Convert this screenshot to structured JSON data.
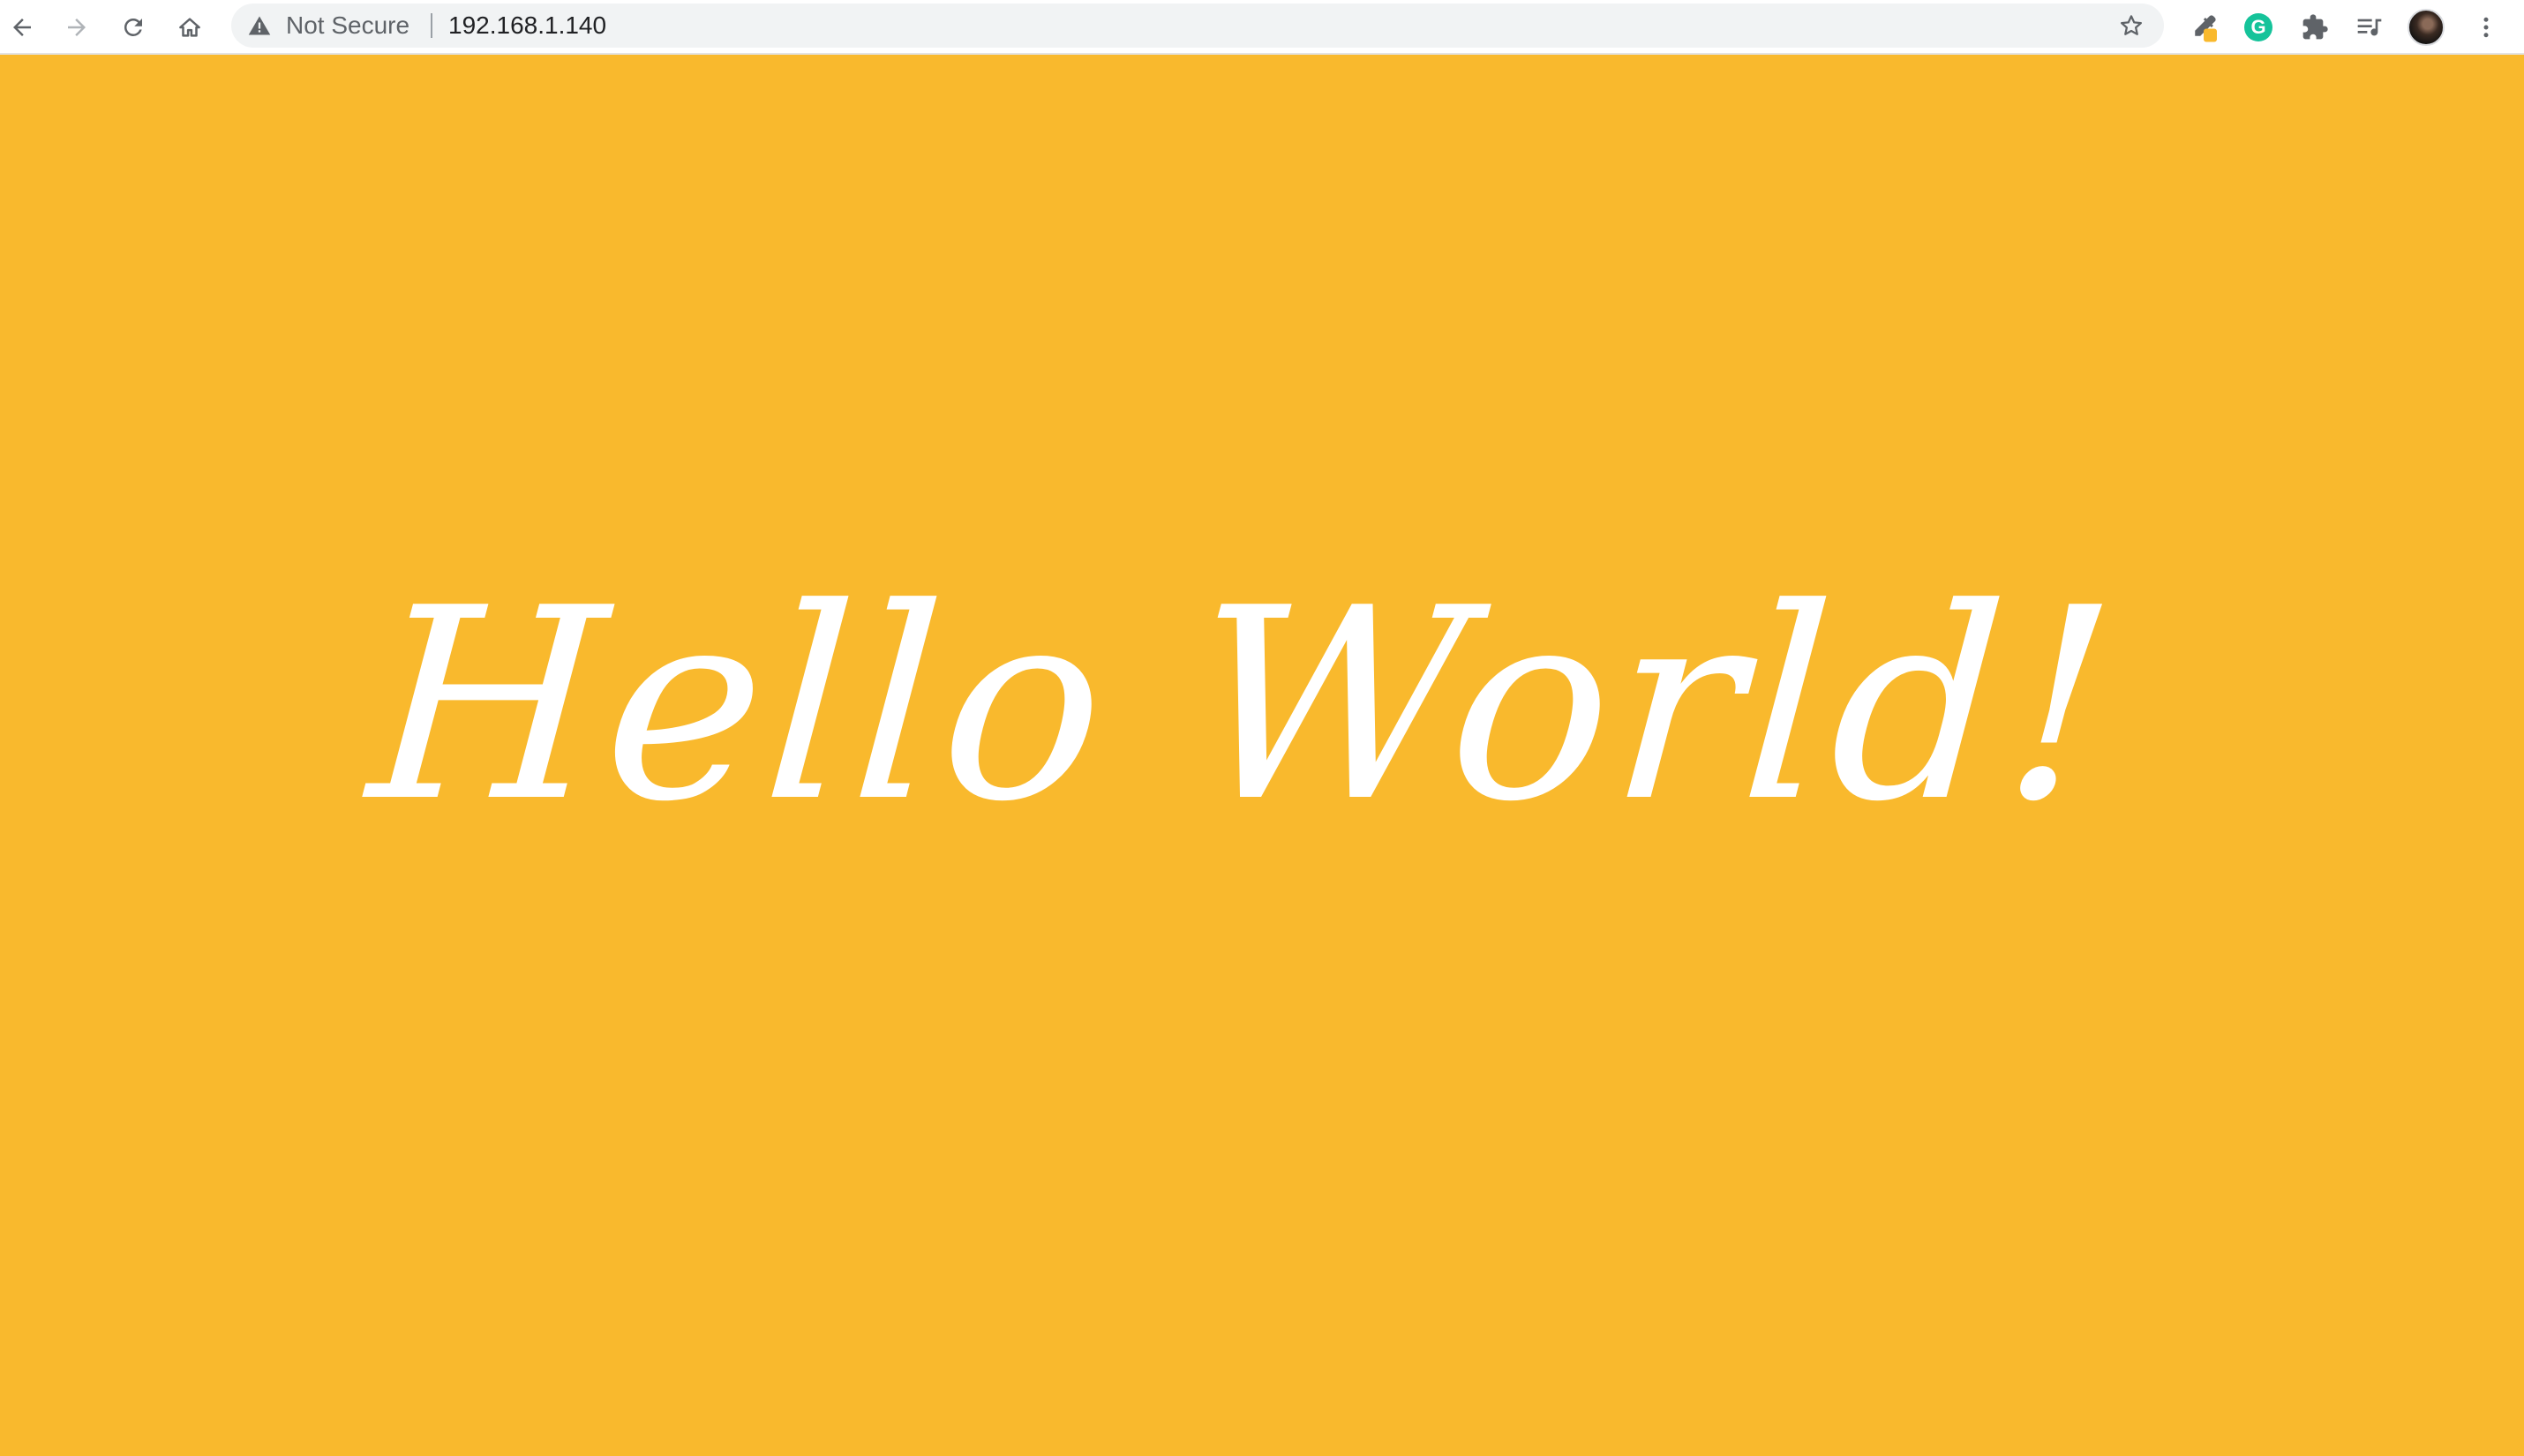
{
  "browser": {
    "security_label": "Not Secure",
    "url": "192.168.1.140",
    "nav": {
      "back_icon": "arrow-left-icon",
      "forward_icon": "arrow-right-icon",
      "reload_icon": "reload-icon",
      "home_icon": "home-icon"
    },
    "extensions": [
      {
        "name": "eyedropper-extension",
        "icon": "eyedropper-icon"
      },
      {
        "name": "grammarly-extension",
        "icon": "grammarly-icon",
        "glyph": "G"
      },
      {
        "name": "extensions-menu",
        "icon": "puzzle-icon"
      },
      {
        "name": "reading-list",
        "icon": "reading-list-icon"
      },
      {
        "name": "profile",
        "icon": "avatar"
      },
      {
        "name": "browser-menu",
        "icon": "kebab-menu-icon"
      }
    ]
  },
  "page": {
    "heading": "Hello World!"
  },
  "colors": {
    "page_background": "#f9b92d",
    "heading_text": "#ffffff",
    "grammarly": "#15c39a"
  }
}
